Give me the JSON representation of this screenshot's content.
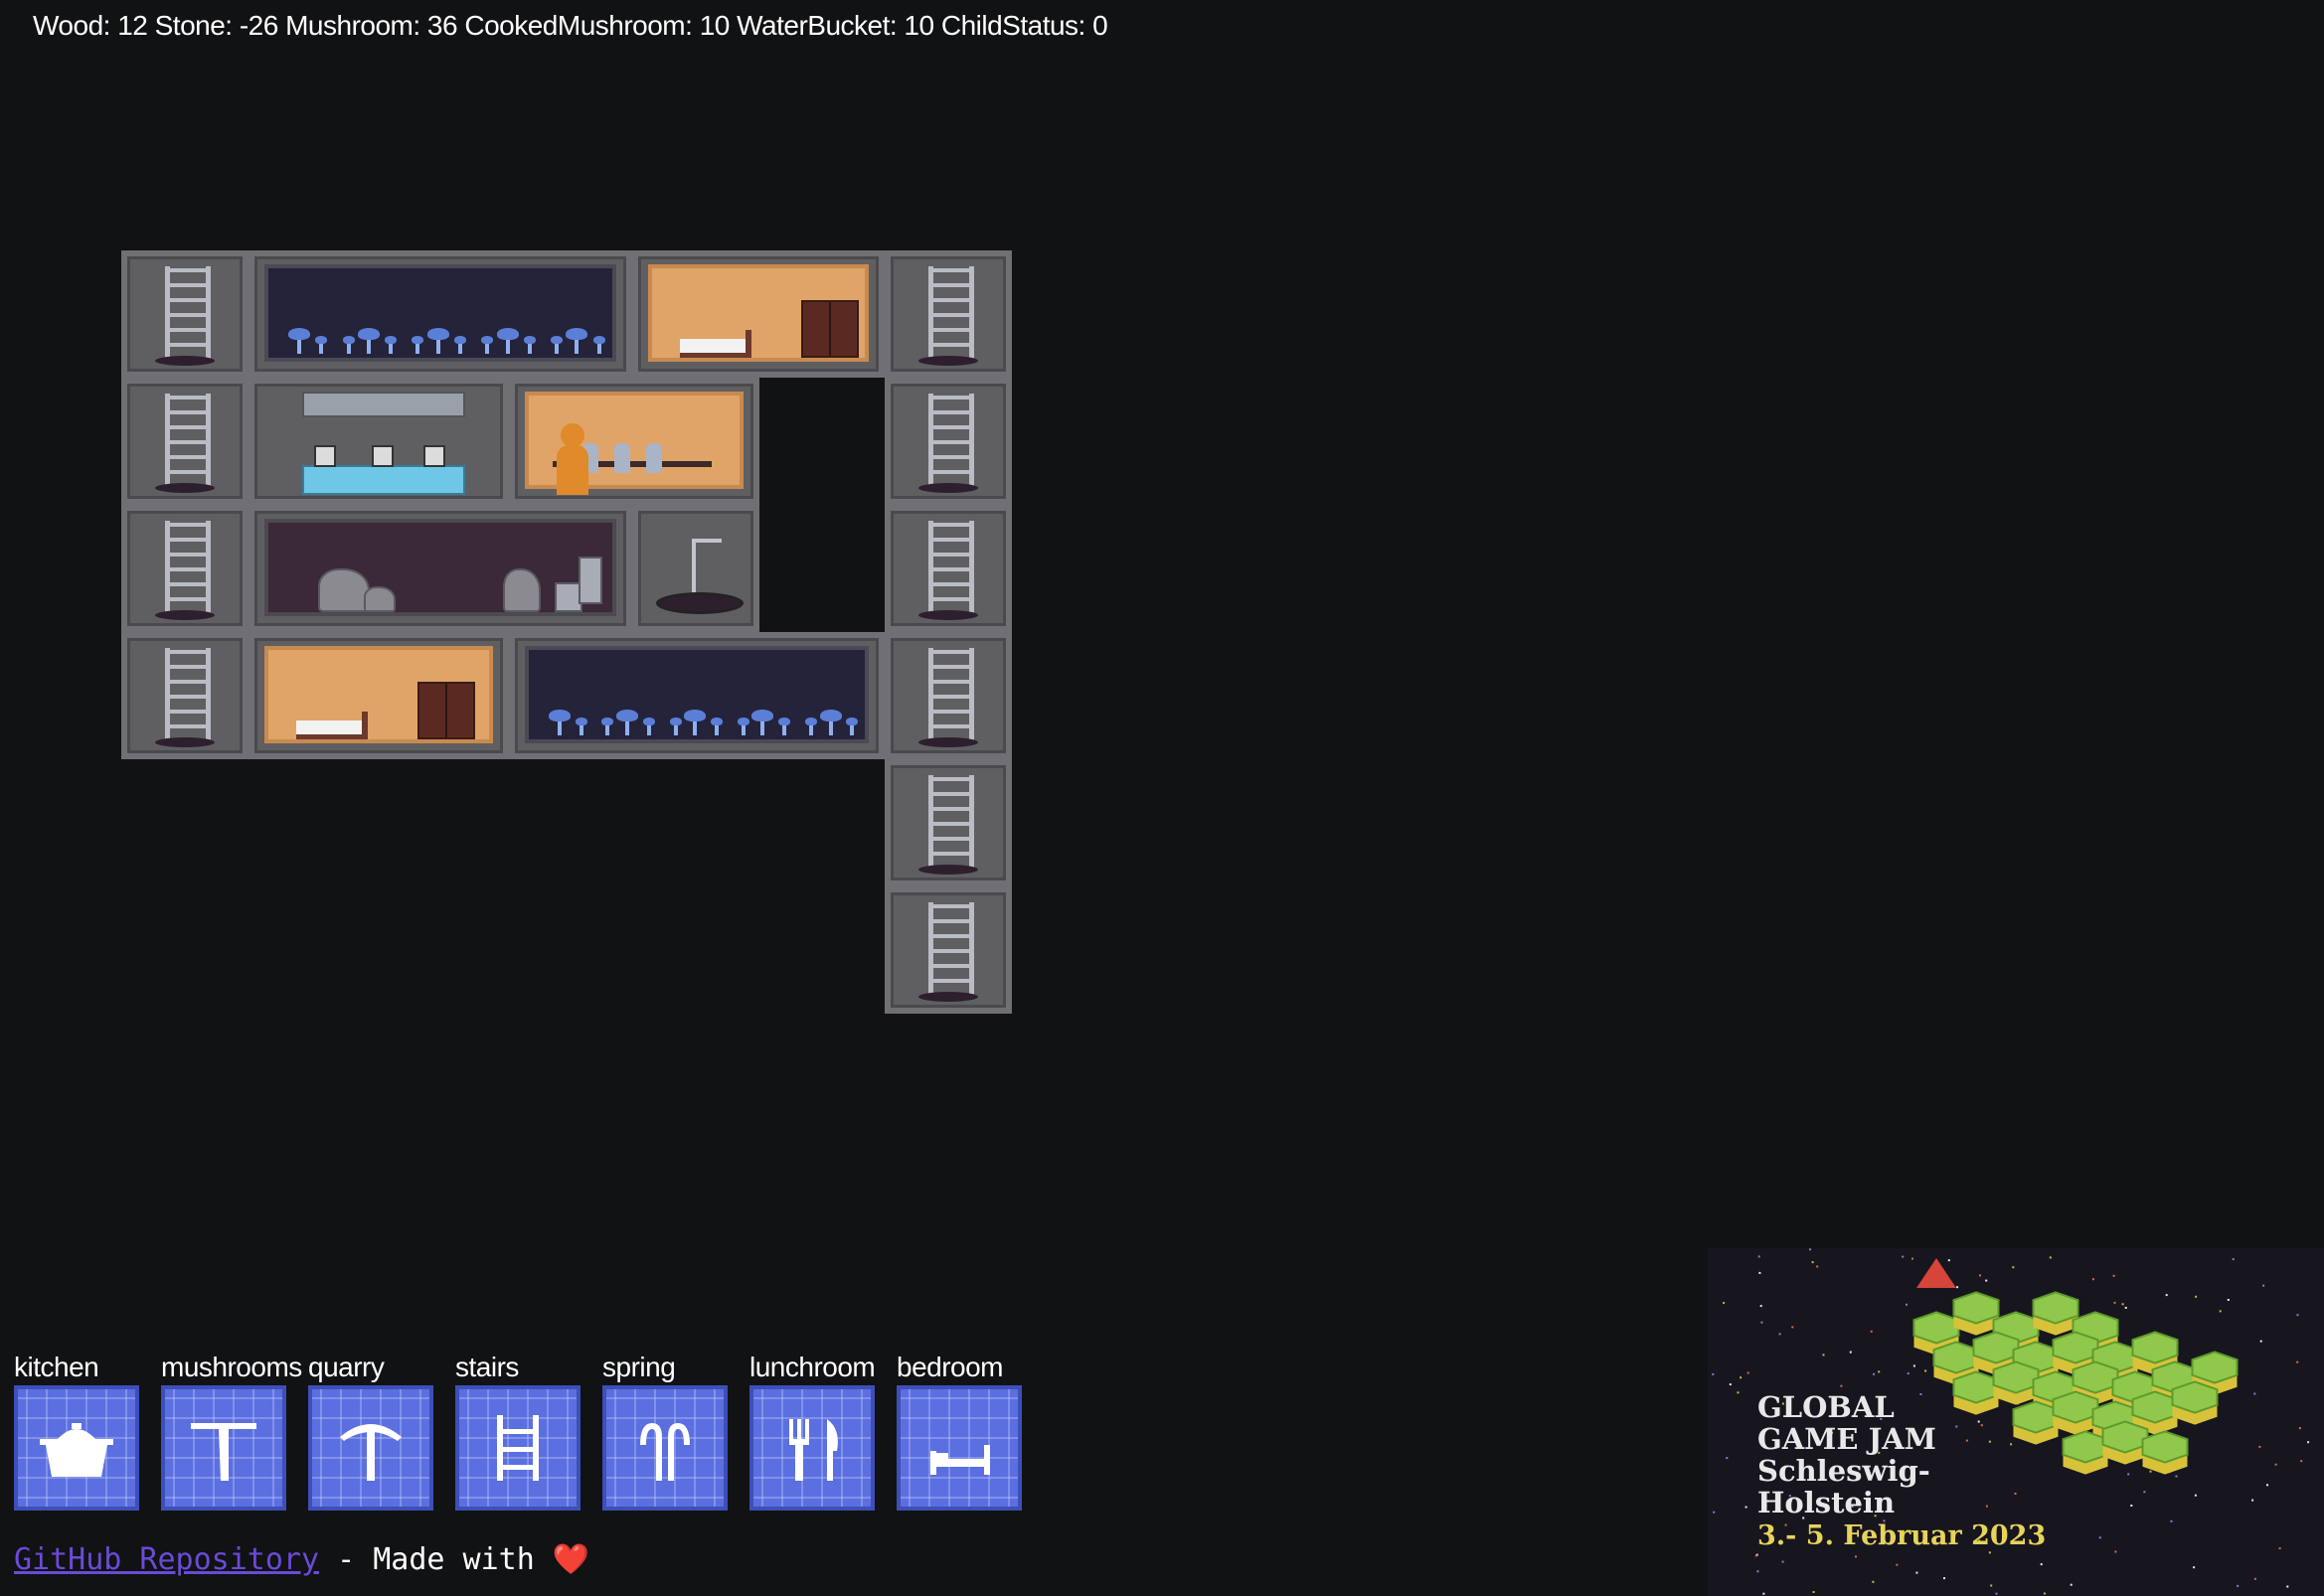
{
  "stats": {
    "wood": "Wood: 12",
    "stone": "Stone: -26",
    "mushroom": "Mushroom: 36",
    "cooked": "CookedMushroom: 10",
    "water": "WaterBucket: 10",
    "child": "ChildStatus: 0"
  },
  "toolbar": [
    {
      "label": "kitchen",
      "icon": "pot-icon"
    },
    {
      "label": "mushrooms",
      "icon": "scythe-icon"
    },
    {
      "label": "quarry",
      "icon": "pickaxe-icon"
    },
    {
      "label": "stairs",
      "icon": "ladder-icon"
    },
    {
      "label": "spring",
      "icon": "water-spring-icon"
    },
    {
      "label": "lunchroom",
      "icon": "fork-knife-icon"
    },
    {
      "label": "bedroom",
      "icon": "bed-icon"
    }
  ],
  "footer": {
    "link": "GitHub Repository",
    "made_with": " - Made with ",
    "heart": "❤️"
  },
  "banner": {
    "line1": "GLOBAL",
    "line2": "GAME JAM",
    "line3": "Schleswig-",
    "line4": "Holstein",
    "date": "3.- 5. Februar 2023"
  },
  "colors": {
    "background": "#111214",
    "tool_button": "#5b6fe0",
    "bedroom_wall": "#e0a468",
    "mushroom_wall": "#24233a",
    "quarry_wall": "#3b2838",
    "link": "#6a4bd6"
  }
}
